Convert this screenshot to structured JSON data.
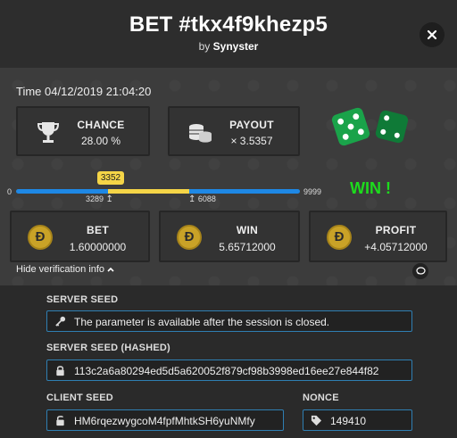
{
  "header": {
    "title": "BET #tkx4f9khezp5",
    "by_prefix": "by",
    "author": "Synyster"
  },
  "bet": {
    "time": "Time 04/12/2019 21:04:20",
    "chance_label": "CHANCE",
    "chance_value": "28.00 %",
    "payout_label": "PAYOUT",
    "payout_value": "× 3.5357",
    "result_text": "WIN !",
    "range": {
      "min_label": "0",
      "max_label": "9999",
      "roll": "3352",
      "win_low": "3289",
      "win_high": "6088"
    },
    "bet_label": "BET",
    "bet_value": "1.60000000",
    "win_label": "WIN",
    "win_value": "5.65712000",
    "profit_label": "PROFIT",
    "profit_value": "+4.05712000",
    "coin_symbol": "Đ",
    "verify_toggle": "Hide verification info"
  },
  "verification": {
    "server_seed_label": "SERVER SEED",
    "server_seed_value": "The parameter is available after the session is closed.",
    "server_seed_hashed_label": "SERVER SEED (HASHED)",
    "server_seed_hashed_value": "113c2a6a80294ed5d5a620052f879cf98b3998ed16ee27e844f82",
    "client_seed_label": "CLIENT SEED",
    "client_seed_value": "HM6rqezwygcoM4fpfMhtkSH6yuNMfy",
    "nonce_label": "NONCE",
    "nonce_value": "149410"
  },
  "colors": {
    "accent_blue": "#1e88e5",
    "win_green": "#1ddc1d",
    "highlight_yellow": "#f5d547",
    "coin_gold": "#c9a227",
    "dice_green": "#1aa34a"
  },
  "icons": [
    "close-icon",
    "trophy-icon",
    "coins-stack-icon",
    "dice-icon",
    "doge-coin-icon",
    "chevron-up-icon",
    "chat-icon",
    "key-icon",
    "lock-icon",
    "unlock-icon",
    "tag-icon"
  ]
}
